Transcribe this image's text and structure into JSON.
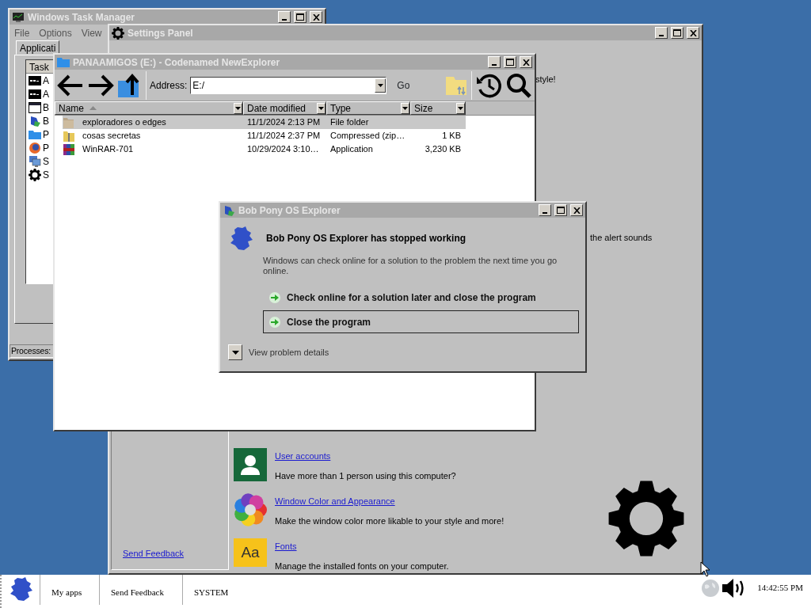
{
  "task_manager": {
    "title": "Windows Task Manager",
    "menu": [
      "File",
      "Options",
      "View"
    ],
    "tab": {
      "label": "Applicati",
      "selected": true
    },
    "column": "Task",
    "tasks": [
      {
        "label": "A",
        "kind": "console"
      },
      {
        "label": "A",
        "kind": "console"
      },
      {
        "label": "B",
        "kind": "window"
      },
      {
        "label": "B",
        "kind": "pony"
      },
      {
        "label": "P",
        "kind": "folder"
      },
      {
        "label": "P",
        "kind": "browser"
      },
      {
        "label": "S",
        "kind": "monitor"
      },
      {
        "label": "S",
        "kind": "gear"
      }
    ],
    "status": "Processes:"
  },
  "settings_panel": {
    "title": "Settings Panel",
    "fragments": [
      "style!",
      "the alert sounds"
    ],
    "items": [
      {
        "kind": "user",
        "link": "User accounts",
        "description": "Have more than 1 person using this computer?"
      },
      {
        "kind": "color",
        "link": "Window Color and Appearance",
        "description": "Make the window color more likable to your style and more!"
      },
      {
        "kind": "fonts",
        "icon_text": "Aa",
        "link": "Fonts",
        "description": "Manage the installed fonts on your computer."
      }
    ],
    "sidebar_link": "Send Feedback"
  },
  "explorer": {
    "title": "PANAAMIGOS (E:) - Codenamed NewExplorer",
    "address_label": "Address:",
    "address": "E:/",
    "go": "Go",
    "columns": [
      "Name",
      "Date modified",
      "Type",
      "Size"
    ],
    "rows": [
      {
        "kind": "folder",
        "name": "exploradores o edges",
        "date": "11/1/2024 2:13 PM",
        "type": "File folder",
        "size": "",
        "selected": true
      },
      {
        "kind": "zip",
        "name": "cosas secretas",
        "date": "11/1/2024 2:37 PM",
        "type": "Compressed (zip…",
        "size": "1 KB",
        "selected": false
      },
      {
        "kind": "app",
        "name": "WinRAR-701",
        "date": "10/29/2024 3:10…",
        "type": "Application",
        "size": "3,230 KB",
        "selected": false
      }
    ]
  },
  "dialog": {
    "title": "Bob Pony OS Explorer",
    "heading": "Bob Pony OS Explorer has stopped working",
    "message": "Windows can check online for a solution to the problem the next time you go online.",
    "options": [
      {
        "label": "Check online for a solution later and close the program",
        "selected": false
      },
      {
        "label": "Close the program",
        "selected": true
      }
    ],
    "details": "View problem details"
  },
  "taskbar": {
    "items": [
      "My apps",
      "Send Feedback",
      "SYSTEM"
    ],
    "clock": "14:42:55 PM"
  }
}
